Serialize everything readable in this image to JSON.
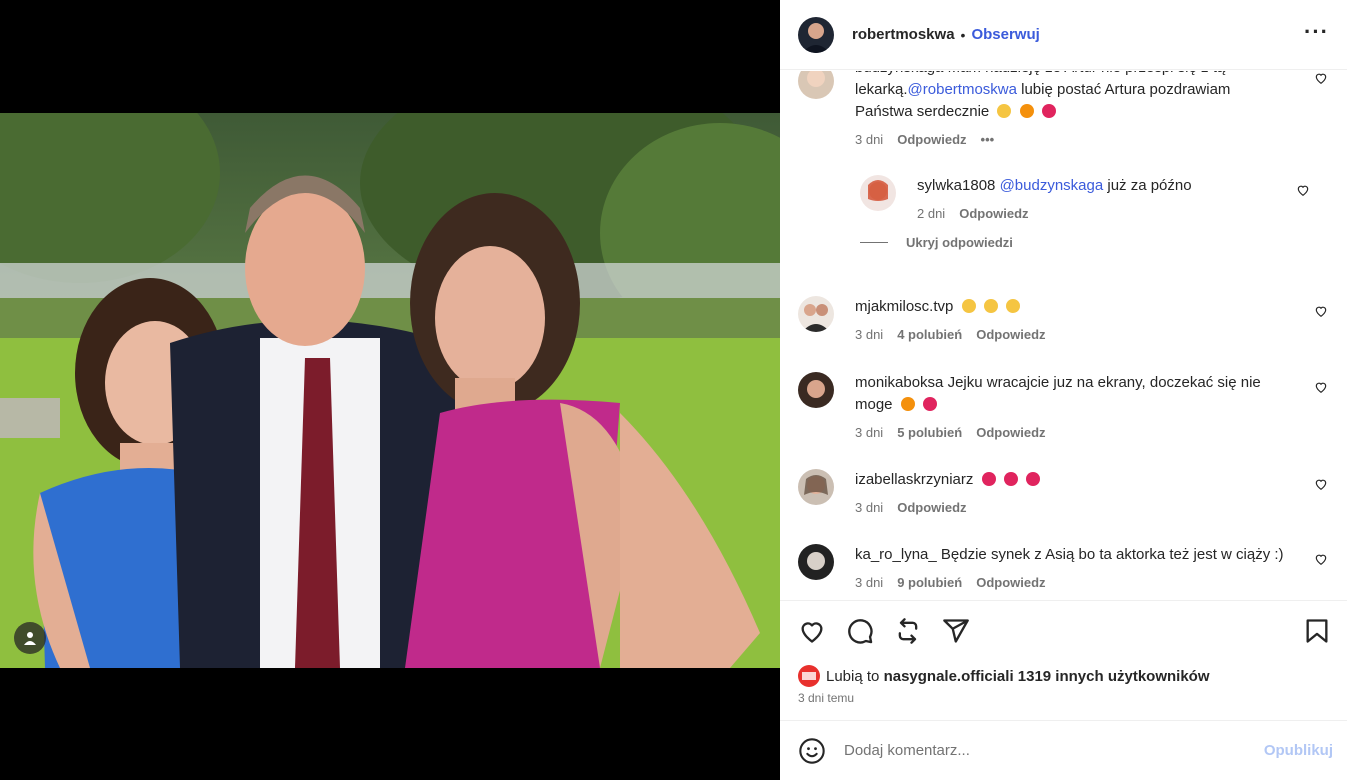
{
  "header": {
    "username": "robertmoskwa",
    "separator": "•",
    "follow_label": "Obserwuj",
    "more_label": "···"
  },
  "comments": [
    {
      "username": "budzynskaga",
      "text_a": "Mam nadzieję że Artur nie prześpi się z tą lekarką.",
      "mention": "@robertmoskwa",
      "text_b": " lubię postać Artura pozdrawiam Państwa serdecznie",
      "time": "3 dni",
      "reply_label": "Odpowiedz",
      "more_label": "•••"
    },
    {
      "username": "sylwka1808",
      "mention": "@budzynskaga",
      "text": " już za późno",
      "time": "2 dni",
      "reply_label": "Odpowiedz"
    },
    {
      "username": "mjakmilosc.tvp",
      "text": "",
      "time": "3 dni",
      "likes": "4 polubień",
      "reply_label": "Odpowiedz"
    },
    {
      "username": "monikaboksa",
      "text": "Jejku wracajcie juz na ekrany, doczekać się nie moge",
      "time": "3 dni",
      "likes": "5 polubień",
      "reply_label": "Odpowiedz"
    },
    {
      "username": "izabellaskrzyniarz",
      "text": "",
      "time": "3 dni",
      "reply_label": "Odpowiedz"
    },
    {
      "username": "ka_ro_lyna_",
      "text": "Będzie synek z Asią bo ta aktorka też jest w ciąży :)",
      "time": "3 dni",
      "likes": "9 polubień",
      "reply_label": "Odpowiedz"
    }
  ],
  "hide_replies_label": "Ukryj odpowiedzi",
  "likes": {
    "prefix": "Lubią to",
    "user": "nasygnale.official",
    "suffix": " i 1319 innych użytkowników"
  },
  "post_time": "3 dni temu",
  "add_comment": {
    "placeholder": "Dodaj komentarz...",
    "publish_label": "Opublikuj"
  },
  "icons": {
    "like": "heart-icon",
    "comment": "comment-icon",
    "repost": "repost-icon",
    "share": "share-icon",
    "save": "bookmark-icon",
    "emoji": "emoji-icon",
    "user_tag": "user-tag-icon"
  },
  "colors": {
    "accent": "#3b5bdb",
    "publish_disabled": "#b2c7f5",
    "heart_emoji": "#e0245e",
    "fire_emoji": "#f4900c"
  }
}
